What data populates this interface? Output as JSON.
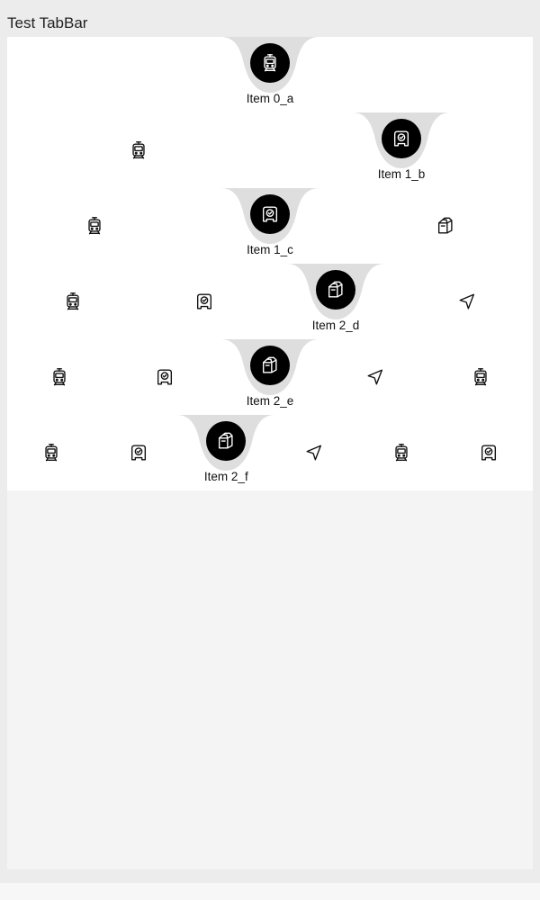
{
  "app": {
    "title": "Test TabBar"
  },
  "colors": {
    "active_bubble": "#000000",
    "notch": "#dedede",
    "bar": "#ffffff",
    "panel": "#f4f4f4"
  },
  "tabbars": [
    {
      "tabs": [
        {
          "icon": "train-icon",
          "label": "Item 0_a",
          "active": true
        }
      ]
    },
    {
      "tabs": [
        {
          "icon": "train-icon",
          "label": "",
          "active": false
        },
        {
          "icon": "verified-badge-icon",
          "label": "Item 1_b",
          "active": true
        }
      ]
    },
    {
      "tabs": [
        {
          "icon": "train-icon",
          "label": "",
          "active": false
        },
        {
          "icon": "verified-badge-icon",
          "label": "Item 1_c",
          "active": true
        },
        {
          "icon": "box-icon",
          "label": "",
          "active": false
        }
      ]
    },
    {
      "tabs": [
        {
          "icon": "train-icon",
          "label": "",
          "active": false
        },
        {
          "icon": "verified-badge-icon",
          "label": "",
          "active": false
        },
        {
          "icon": "box-icon",
          "label": "Item 2_d",
          "active": true
        },
        {
          "icon": "navigation-arrow-icon",
          "label": "",
          "active": false
        }
      ]
    },
    {
      "tabs": [
        {
          "icon": "train-icon",
          "label": "",
          "active": false
        },
        {
          "icon": "verified-badge-icon",
          "label": "",
          "active": false
        },
        {
          "icon": "box-icon",
          "label": "Item 2_e",
          "active": true
        },
        {
          "icon": "navigation-arrow-icon",
          "label": "",
          "active": false
        },
        {
          "icon": "train-icon",
          "label": "",
          "active": false
        }
      ]
    },
    {
      "tabs": [
        {
          "icon": "train-icon",
          "label": "",
          "active": false
        },
        {
          "icon": "verified-badge-icon",
          "label": "",
          "active": false
        },
        {
          "icon": "box-icon",
          "label": "Item 2_f",
          "active": true
        },
        {
          "icon": "navigation-arrow-icon",
          "label": "",
          "active": false
        },
        {
          "icon": "train-icon",
          "label": "",
          "active": false
        },
        {
          "icon": "verified-badge-icon",
          "label": "",
          "active": false
        }
      ]
    }
  ]
}
